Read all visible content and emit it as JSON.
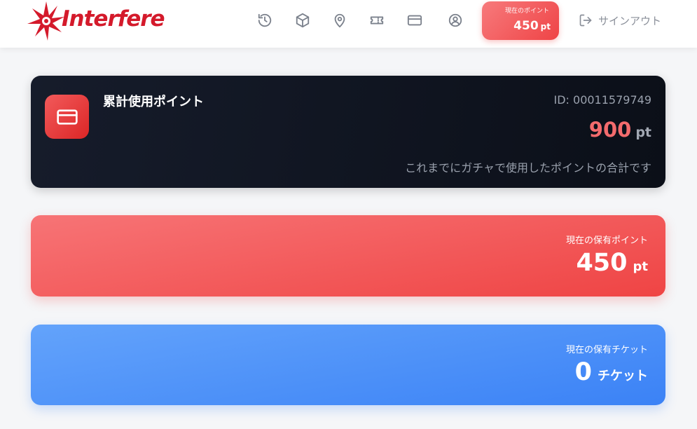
{
  "header": {
    "logo_text": "Interfere",
    "nav_icons": [
      {
        "name": "history-icon"
      },
      {
        "name": "box-icon"
      },
      {
        "name": "location-pin-icon"
      },
      {
        "name": "ticket-icon"
      },
      {
        "name": "credit-card-icon"
      },
      {
        "name": "user-circle-icon"
      }
    ],
    "points_badge": {
      "label": "現在のポイント",
      "value": "450",
      "unit": "pt"
    },
    "signout_label": "サインアウト"
  },
  "cards": {
    "total_used": {
      "title": "累計使用ポイント",
      "id_text": "ID: 00011579749",
      "value": "900",
      "unit": "pt",
      "caption": "これまでにガチャで使用したポイントの合計です"
    },
    "current_points": {
      "label": "現在の保有ポイント",
      "value": "450",
      "unit": "pt"
    },
    "current_tickets": {
      "label": "現在の保有チケット",
      "value": "0",
      "unit": "チケット"
    }
  },
  "colors": {
    "brand_red": "#d41a2b",
    "accent_red": "#ef4444",
    "accent_blue": "#3b82f6",
    "dark_card": "#111827"
  }
}
